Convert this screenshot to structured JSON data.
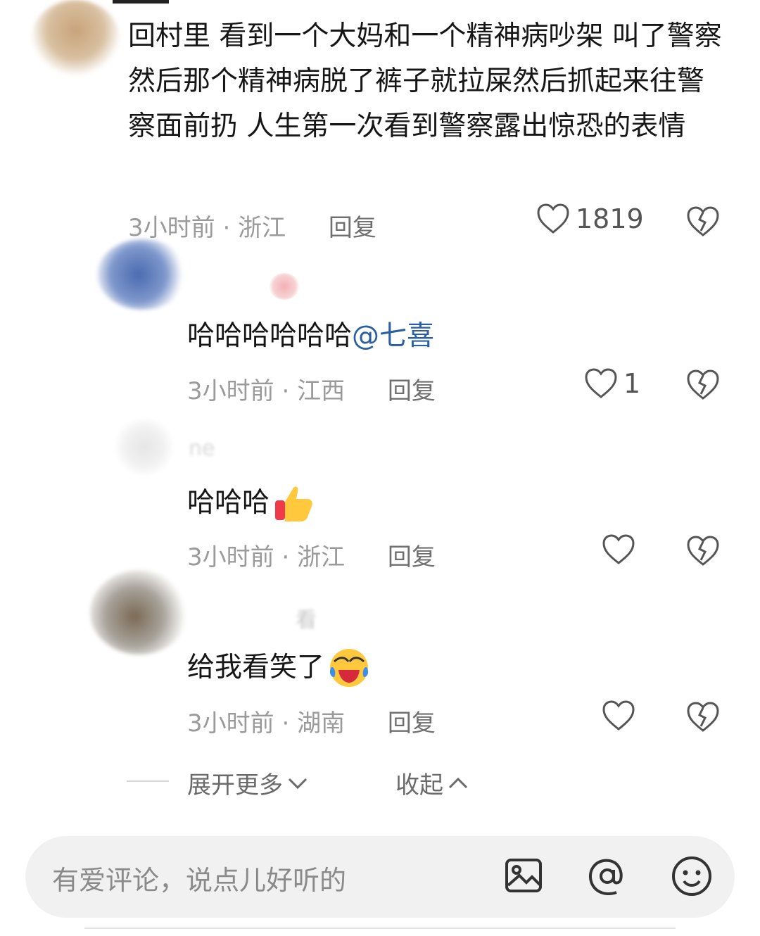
{
  "main_comment": {
    "text": "回村里 看到一个大妈和一个精神病吵架 叫了警察 然后那个精神病脱了裤子就拉屎然后抓起来往警察面前扔 人生第一次看到警察露出惊恐的表情",
    "time": "3小时前",
    "location": "浙江",
    "reply_label": "回复",
    "like_count": "1819"
  },
  "replies": [
    {
      "text_prefix": "哈哈哈哈哈哈",
      "mention": "@七喜",
      "time": "3小时前",
      "location": "江西",
      "reply_label": "回复",
      "like_count": "1"
    },
    {
      "username": "ne",
      "text_prefix": "哈哈哈",
      "emoji": "thumbs-up",
      "time": "3小时前",
      "location": "浙江",
      "reply_label": "回复",
      "like_count": ""
    },
    {
      "username": "看",
      "text_prefix": "给我看笑了",
      "emoji": "laughing-crying",
      "time": "3小时前",
      "location": "湖南",
      "reply_label": "回复",
      "like_count": ""
    }
  ],
  "thread": {
    "expand_label": "展开更多",
    "collapse_label": "收起"
  },
  "input": {
    "placeholder": "有爱评论，说点儿好听的",
    "icons": [
      "image-icon",
      "at-icon",
      "emoji-icon"
    ]
  },
  "colors": {
    "mention": "#2b5fa3",
    "meta": "#9a9a9a",
    "input_bg": "#f1f1f1"
  }
}
